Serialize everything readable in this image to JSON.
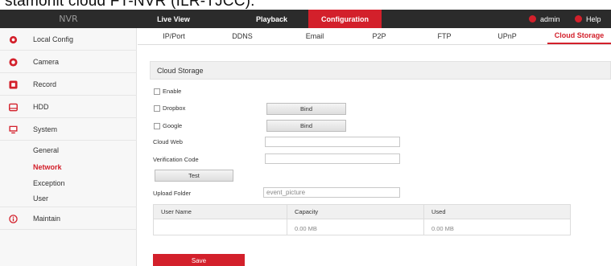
{
  "caption": "stamohlt cloud FT-NVR (ILR-TJCC).",
  "topbar": {
    "logo": "NVR",
    "tabs": [
      {
        "label": "Live View"
      },
      {
        "label": "Playback"
      },
      {
        "label": "Configuration",
        "active": true
      }
    ],
    "user": "admin",
    "help": "Help",
    "accent_color": "#d3202b"
  },
  "sidebar": {
    "items": [
      {
        "label": "Local Config",
        "icon": "gear-icon"
      },
      {
        "label": "Camera",
        "icon": "camera-icon"
      },
      {
        "label": "Record",
        "icon": "record-icon"
      },
      {
        "label": "HDD",
        "icon": "hdd-icon"
      },
      {
        "label": "System",
        "icon": "monitor-icon"
      },
      {
        "label": "Maintain",
        "icon": "info-icon"
      }
    ],
    "system_sub": [
      {
        "label": "General"
      },
      {
        "label": "Network",
        "active": true
      },
      {
        "label": "Exception"
      },
      {
        "label": "User"
      }
    ]
  },
  "subtabs": [
    {
      "label": "IP/Port"
    },
    {
      "label": "DDNS"
    },
    {
      "label": "Email"
    },
    {
      "label": "P2P"
    },
    {
      "label": "FTP"
    },
    {
      "label": "UPnP"
    },
    {
      "label": "Cloud Storage",
      "active": true
    }
  ],
  "cloud": {
    "section_title": "Cloud Storage",
    "enable_label": "Enable",
    "dropbox_label": "Dropbox",
    "google_label": "Google",
    "bind_label": "Bind",
    "cloud_web_label": "Cloud Web",
    "cloud_web_value": "",
    "verification_label": "Verification Code",
    "verification_value": "",
    "test_label": "Test",
    "upload_folder_label": "Upload Folder",
    "upload_folder_value": "event_picture",
    "table": {
      "headers": [
        "User Name",
        "Capacity",
        "Used"
      ],
      "rows": [
        [
          "",
          "0.00 MB",
          "0.00 MB"
        ]
      ]
    },
    "save_label": "Save"
  }
}
